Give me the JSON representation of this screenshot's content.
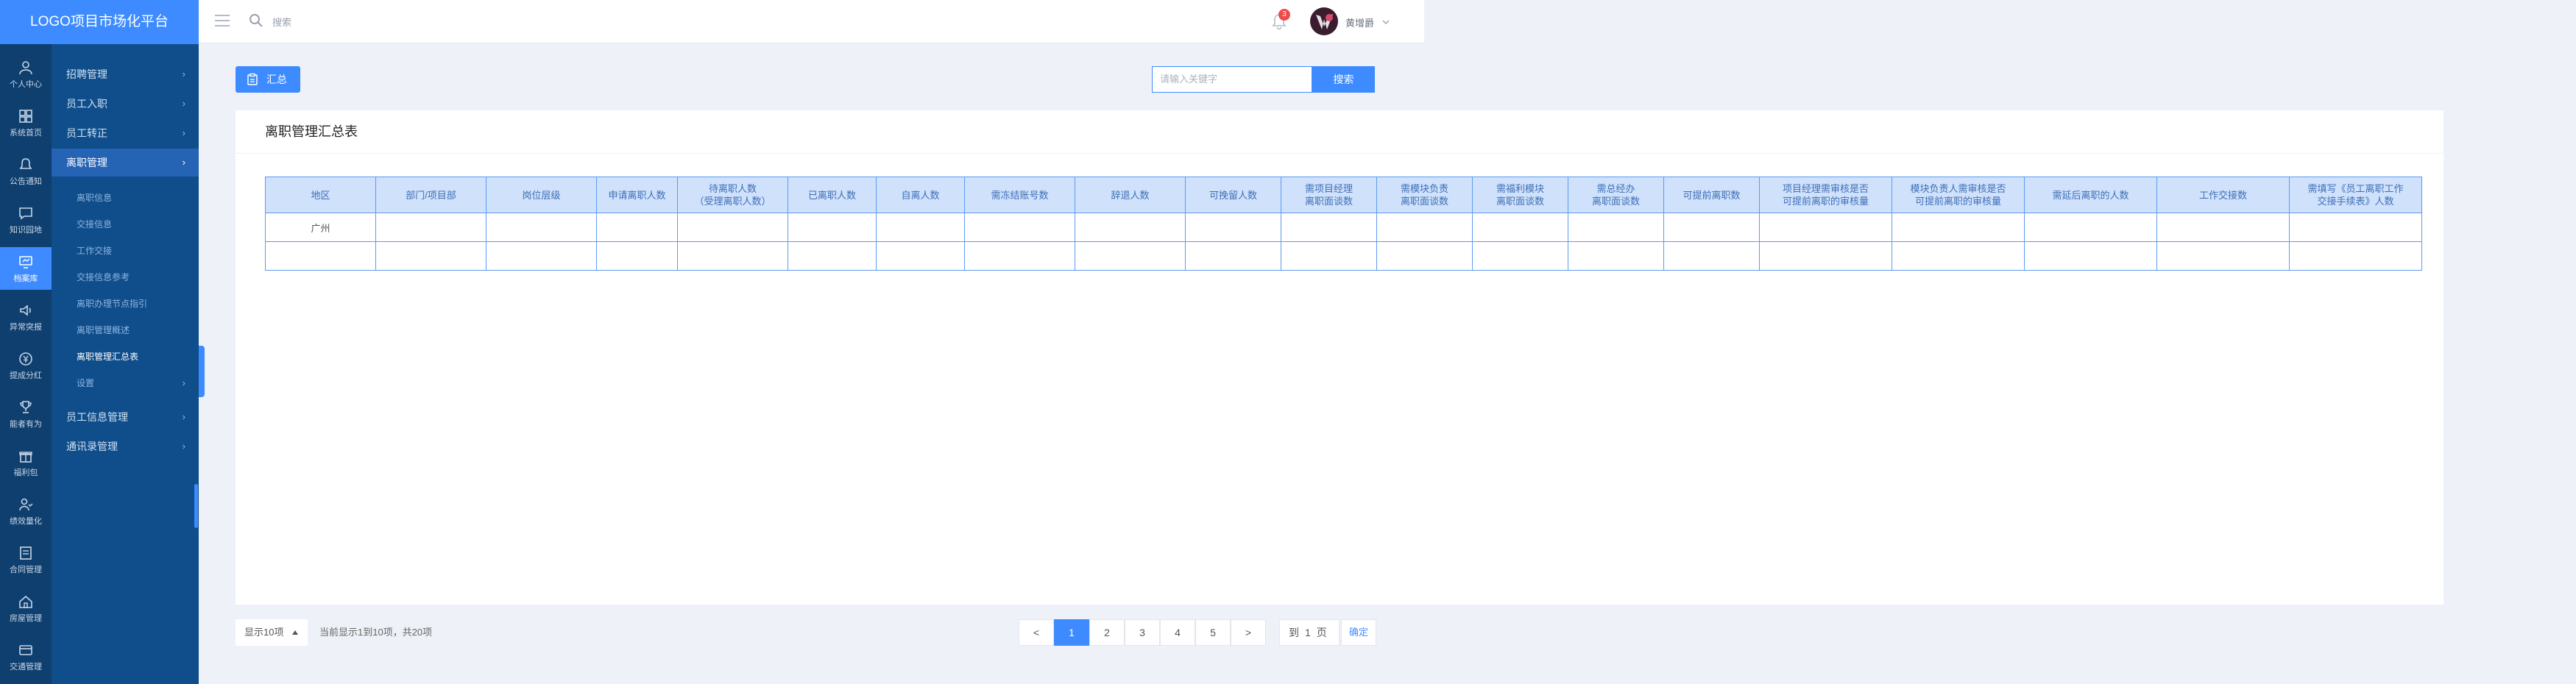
{
  "app": {
    "title": "LOGO项目市场化平台"
  },
  "topbar": {
    "search_text": "搜索",
    "notification_count": "3",
    "username": "黄增爵"
  },
  "iconbar": [
    {
      "label": "个人中心",
      "icon": "user-icon"
    },
    {
      "label": "系统首页",
      "icon": "grid-icon"
    },
    {
      "label": "公告通知",
      "icon": "bell-icon"
    },
    {
      "label": "知识园地",
      "icon": "message-icon"
    },
    {
      "label": "档案库",
      "icon": "monitor-icon"
    },
    {
      "label": "异常突报",
      "icon": "speaker-icon"
    },
    {
      "label": "提成分红",
      "icon": "yen-icon"
    },
    {
      "label": "能者有为",
      "icon": "trophy-icon"
    },
    {
      "label": "福利包",
      "icon": "gift-icon"
    },
    {
      "label": "绩效量化",
      "icon": "users-icon"
    },
    {
      "label": "合同管理",
      "icon": "contract-icon"
    },
    {
      "label": "房屋管理",
      "icon": "home-icon"
    },
    {
      "label": "交通管理",
      "icon": "card-icon"
    }
  ],
  "menu": {
    "items": [
      {
        "label": "招聘管理"
      },
      {
        "label": "员工入职"
      },
      {
        "label": "员工转正"
      },
      {
        "label": "离职管理"
      }
    ],
    "sub_items": [
      {
        "label": "离职信息"
      },
      {
        "label": "交接信息"
      },
      {
        "label": "工作交接"
      },
      {
        "label": "交接信息参考"
      },
      {
        "label": "离职办理节点指引"
      },
      {
        "label": "离职管理概述"
      },
      {
        "label": "离职管理汇总表"
      },
      {
        "label": "设置"
      }
    ],
    "bottom_items": [
      {
        "label": "员工信息管理"
      },
      {
        "label": "通讯录管理"
      }
    ]
  },
  "toolbar": {
    "summary_label": "汇总",
    "search_placeholder": "请输入关键字",
    "search_button": "搜索"
  },
  "report": {
    "title": "离职管理汇总表",
    "columns": [
      "地区",
      "部门/项目部",
      "岗位层级",
      "申请离职人数",
      "待离职人数\n（受理离职人数）",
      "已离职人数",
      "自离人数",
      "需冻结账号数",
      "辞退人数",
      "可挽留人数",
      "需项目经理\n离职面谈数",
      "需模块负责\n离职面谈数",
      "需福利模块\n离职面谈数",
      "需总经办\n离职面谈数",
      "可提前离职数",
      "项目经理需审核是否\n可提前离职的审核量",
      "模块负责人需审核是否\n可提前离职的审核量",
      "需延后离职的人数",
      "工作交接数",
      "需填写《员工离职工作\n交接手续表》人数"
    ],
    "rows": [
      [
        "广州",
        "",
        "",
        "",
        "",
        "",
        "",
        "",
        "",
        "",
        "",
        "",
        "",
        "",
        "",
        "",
        "",
        "",
        "",
        ""
      ],
      [
        "",
        "",
        "",
        "",
        "",
        "",
        "",
        "",
        "",
        "",
        "",
        "",
        "",
        "",
        "",
        "",
        "",
        "",
        "",
        ""
      ]
    ]
  },
  "pagination": {
    "page_size": "显示10项",
    "info": "当前显示1到10项，共20项",
    "prev": "<",
    "next": ">",
    "pages": [
      "1",
      "2",
      "3",
      "4",
      "5"
    ],
    "active_page": "1",
    "goto_prefix": "到",
    "goto_value": "1",
    "goto_suffix": "页",
    "confirm": "确定"
  },
  "colors": {
    "accent": "#3d8bff",
    "sidebar_dark": "#0e3f6f",
    "menu_bg": "#0f4e8a",
    "table_header": "#cfe1fb",
    "table_border": "#5b9bf1"
  }
}
